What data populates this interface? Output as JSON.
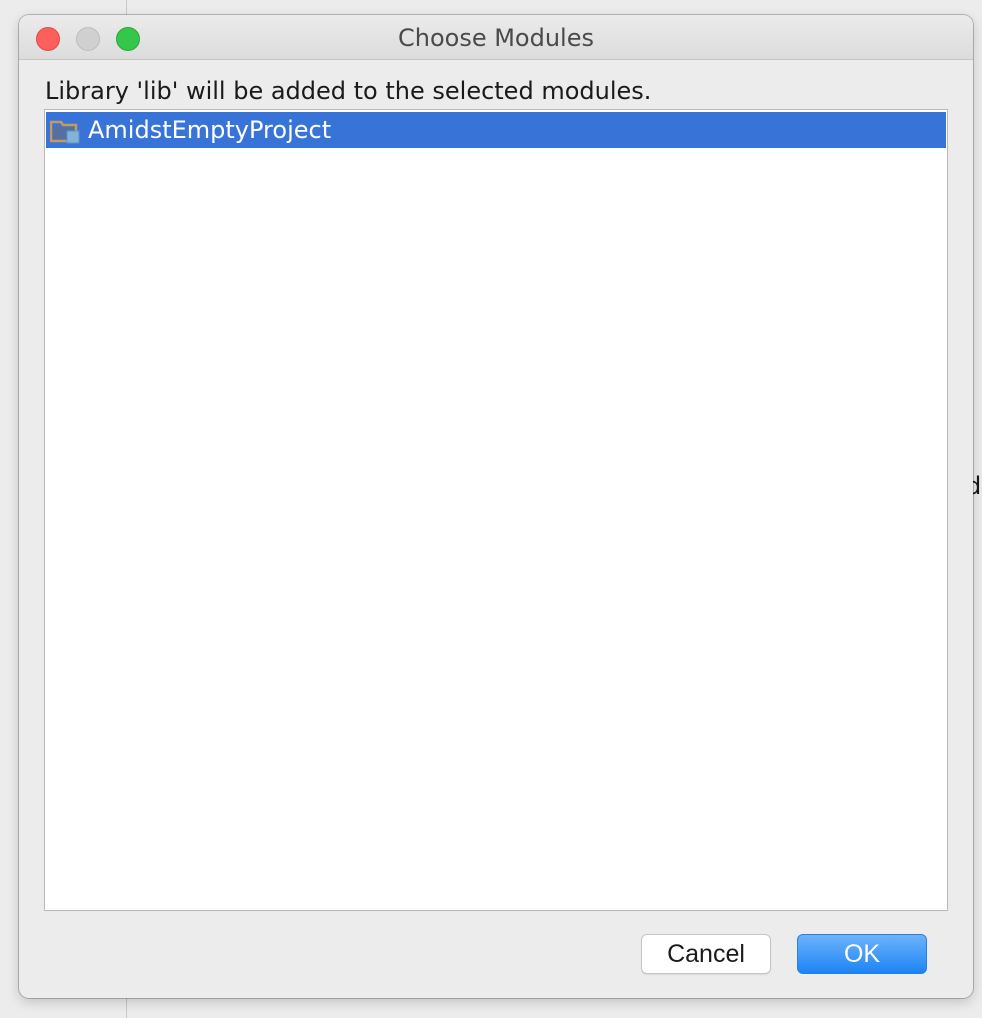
{
  "background": {
    "partial_text": "d"
  },
  "dialog": {
    "title": "Choose Modules",
    "message": "Library 'lib' will be added to the selected modules.",
    "modules": [
      {
        "name": "AmidstEmptyProject",
        "icon": "module-folder-icon",
        "selected": true
      }
    ],
    "buttons": {
      "cancel_label": "Cancel",
      "ok_label": "OK"
    }
  },
  "colors": {
    "selection": "#3874d8",
    "primary_button": "#1d84f5",
    "close": "#fc605c",
    "zoom": "#34c749"
  }
}
